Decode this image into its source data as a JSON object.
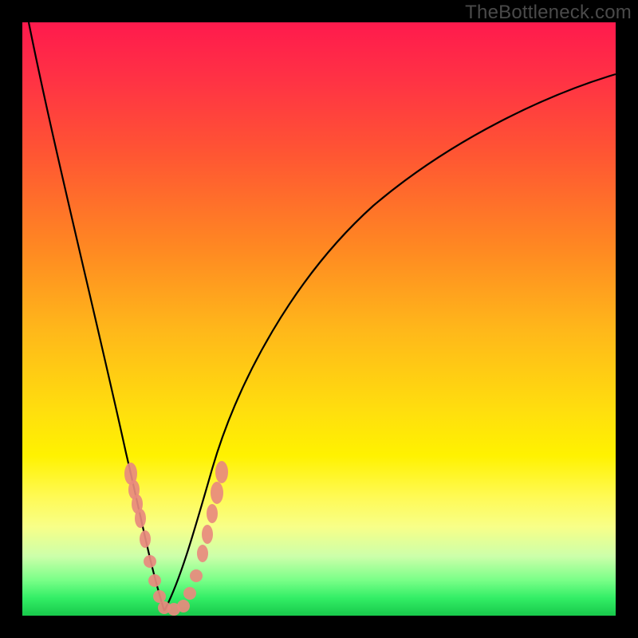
{
  "watermark": "TheBottleneck.com",
  "chart_data": {
    "type": "line",
    "title": "",
    "xlabel": "",
    "ylabel": "",
    "xlim": [
      0,
      100
    ],
    "ylim": [
      0,
      100
    ],
    "grid": false,
    "legend": false,
    "description": "Bottleneck percentage curve: two asymptotic branches descending to a near-zero minimum around x≈24. Background gradient encodes bottleneck severity (red=high, green=low). Salmon bead markers highlight measured sample points near the valley minimum.",
    "series": [
      {
        "name": "left-branch",
        "x": [
          1,
          4,
          8,
          13,
          18,
          20,
          22,
          24
        ],
        "y": [
          100,
          72,
          44,
          26,
          14,
          8,
          3,
          0
        ]
      },
      {
        "name": "right-branch",
        "x": [
          24,
          27,
          30,
          35,
          42,
          55,
          70,
          85,
          100
        ],
        "y": [
          0,
          4,
          10,
          20,
          34,
          52,
          62,
          70,
          75
        ]
      }
    ],
    "markers": {
      "name": "sample-points",
      "color": "#e88a7e",
      "points": [
        {
          "x": 18,
          "y": 22
        },
        {
          "x": 18.5,
          "y": 19
        },
        {
          "x": 19,
          "y": 16
        },
        {
          "x": 19.5,
          "y": 13
        },
        {
          "x": 20.5,
          "y": 9
        },
        {
          "x": 21,
          "y": 6
        },
        {
          "x": 22,
          "y": 3
        },
        {
          "x": 23,
          "y": 1
        },
        {
          "x": 24,
          "y": 0
        },
        {
          "x": 25,
          "y": 0.5
        },
        {
          "x": 26,
          "y": 1
        },
        {
          "x": 27,
          "y": 3
        },
        {
          "x": 28,
          "y": 6
        },
        {
          "x": 29,
          "y": 10
        },
        {
          "x": 30,
          "y": 14
        },
        {
          "x": 31,
          "y": 18
        },
        {
          "x": 32,
          "y": 22
        }
      ]
    }
  }
}
